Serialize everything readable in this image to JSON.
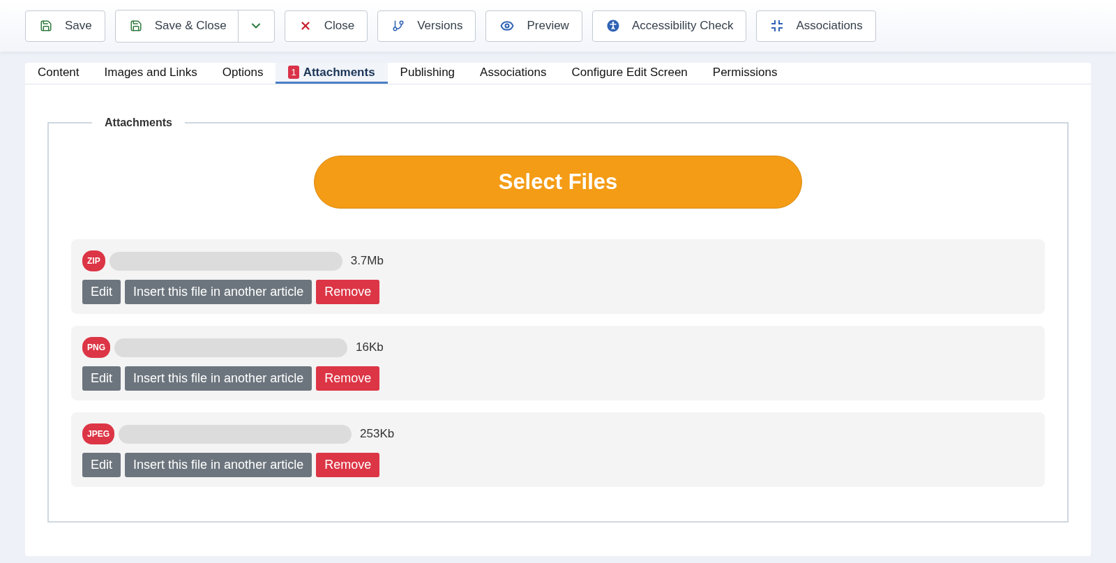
{
  "toolbar": [
    {
      "label": "Save",
      "kind": "save",
      "has_dropdown": false
    },
    {
      "label": "Save & Close",
      "kind": "save",
      "has_dropdown": true
    },
    {
      "label": "Close",
      "kind": "close",
      "has_dropdown": false
    },
    {
      "label": "Versions",
      "kind": "versions",
      "has_dropdown": false
    },
    {
      "label": "Preview",
      "kind": "preview",
      "has_dropdown": false
    },
    {
      "label": "Accessibility Check",
      "kind": "accessibility",
      "has_dropdown": false
    },
    {
      "label": "Associations",
      "kind": "associations",
      "has_dropdown": false
    }
  ],
  "tabs": [
    {
      "label": "Content",
      "selected": false
    },
    {
      "label": "Images and Links",
      "selected": false
    },
    {
      "label": "Options",
      "selected": false
    },
    {
      "label": "Attachments",
      "selected": true,
      "badge": "1"
    },
    {
      "label": "Publishing",
      "selected": false
    },
    {
      "label": "Associations",
      "selected": false
    },
    {
      "label": "Configure Edit Screen",
      "selected": false
    },
    {
      "label": "Permissions",
      "selected": false
    }
  ],
  "attachments": {
    "legend": "Attachments",
    "select_button": "Select Files",
    "files": [
      {
        "type": "ZIP",
        "size": "3.7Mb",
        "actions": [
          {
            "label": "Edit",
            "kind": "secondary"
          },
          {
            "label": "Insert this file in another article",
            "kind": "secondary"
          },
          {
            "label": "Remove",
            "kind": "danger"
          }
        ]
      },
      {
        "type": "PNG",
        "size": "16Kb",
        "actions": [
          {
            "label": "Edit",
            "kind": "secondary"
          },
          {
            "label": "Insert this file in another article",
            "kind": "secondary"
          },
          {
            "label": "Remove",
            "kind": "danger"
          }
        ]
      },
      {
        "type": "JPEG",
        "size": "253Kb",
        "actions": [
          {
            "label": "Edit",
            "kind": "secondary"
          },
          {
            "label": "Insert this file in another article",
            "kind": "secondary"
          },
          {
            "label": "Remove",
            "kind": "danger"
          }
        ]
      }
    ]
  }
}
